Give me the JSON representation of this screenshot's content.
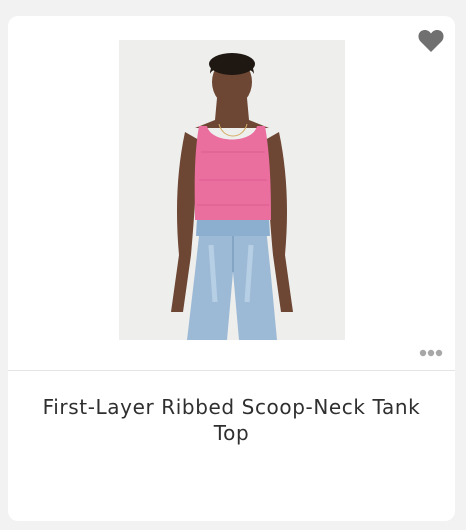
{
  "product": {
    "title": "First-Layer Ribbed Scoop-Neck Tank Top",
    "image_alt": "Model wearing a pink ribbed scoop-neck tank top with light-wash wide-leg jeans"
  },
  "actions": {
    "favorite_icon": "heart-icon",
    "more_icon": "more-options-icon"
  },
  "colors": {
    "tank": "#ea6f9f",
    "denim": "#9cbad6",
    "heart": "#707070",
    "dots": "#a7a7a7"
  }
}
